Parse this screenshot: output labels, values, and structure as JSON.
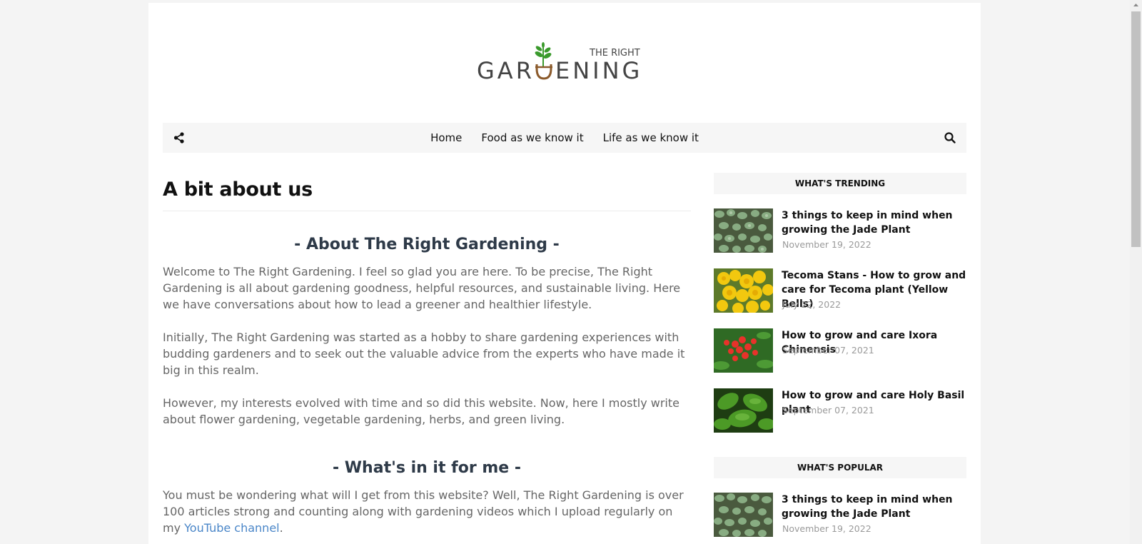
{
  "site": {
    "logo_small": "THE RIGHT",
    "logo_big": "GARDENING"
  },
  "nav": {
    "items": [
      "Home",
      "Food as we know it",
      "Life as we know it"
    ]
  },
  "main": {
    "title": "A bit about us",
    "sections": [
      {
        "heading": "- About The Right Gardening -",
        "paragraphs": [
          "Welcome to The Right Gardening. I feel so glad you are here. To be precise, The Right Gardening is all about gardening goodness, helpful resources, and sustainable living. Here we have conversations about how to lead a greener and healthier lifestyle.",
          "Initially, The Right Gardening was started as a hobby to share gardening experiences with budding gardeners and to seek out the valuable advice from the experts who have made it big in this realm.",
          "However, my interests evolved with time and so did this website. Now, here I mostly write about flower gardening, vegetable gardening, herbs, and green living."
        ]
      },
      {
        "heading": "- What's in it for me -",
        "paragraph_pre": "You must be wondering what will I get from this website? Well, The Right Gardening is over 100 articles strong and counting along with gardening videos which I upload regularly on my ",
        "link": "YouTube channel",
        "paragraph_post": "."
      }
    ]
  },
  "sidebar": {
    "trending_title": "WHAT'S TRENDING",
    "trending": [
      {
        "title": "3 things to keep in mind when growing the Jade Plant",
        "date": "November 19, 2022",
        "thumb": "jade"
      },
      {
        "title": "Tecoma Stans - How to grow and care for Tecoma plant (Yellow Bells)",
        "date": "July 22, 2022",
        "thumb": "tecoma"
      },
      {
        "title": "How to grow and care Ixora Chinensis",
        "date": "September 07, 2021",
        "thumb": "ixora"
      },
      {
        "title": "How to grow and care Holy Basil plant",
        "date": "September 07, 2021",
        "thumb": "basil"
      }
    ],
    "popular_title": "WHAT'S POPULAR",
    "popular": [
      {
        "title": "3 things to keep in mind when growing the Jade Plant",
        "date": "November 19, 2022",
        "thumb": "jade"
      }
    ]
  },
  "colors": {
    "heading": "#2e3a48",
    "body_text": "#666666",
    "link": "#4a86c8",
    "logo_text": "#444444",
    "logo_leaf": "#3a9a2c",
    "logo_pot": "#8b5a2b"
  },
  "icons": {
    "share": "share-icon",
    "search": "search-icon"
  }
}
